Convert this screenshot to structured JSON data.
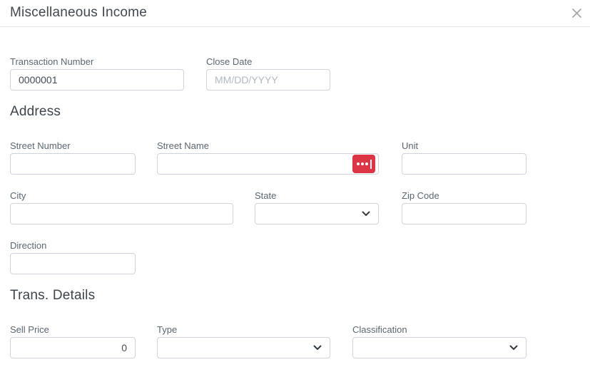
{
  "modal": {
    "title": "Miscellaneous Income"
  },
  "icons": {
    "close": "thin x glyph (two crossed lines)",
    "chevron_down": "bold v chevron on dropdowns",
    "lookup": "three white dots plus cursor bar on red button"
  },
  "colors": {
    "lookup_button_red": "#dc3545",
    "input_border": "#ced4da",
    "label_text": "#5c6670",
    "heading_text": "#3d444b",
    "placeholder_text": "#b2b9c0",
    "close_icon_gray": "#a3a3a3",
    "chevron_dark": "#343a40"
  },
  "sections": {
    "address": {
      "heading": "Address"
    },
    "trans_details": {
      "heading": "Trans. Details"
    }
  },
  "fields": {
    "transaction_number": {
      "label": "Transaction Number",
      "value": "0000001"
    },
    "close_date": {
      "label": "Close Date",
      "placeholder": "MM/DD/YYYY",
      "value": ""
    },
    "street_number": {
      "label": "Street Number",
      "value": ""
    },
    "street_name": {
      "label": "Street Name",
      "value": ""
    },
    "unit": {
      "label": "Unit",
      "value": ""
    },
    "city": {
      "label": "City",
      "value": ""
    },
    "state": {
      "label": "State",
      "selected": ""
    },
    "zip_code": {
      "label": "Zip Code",
      "value": ""
    },
    "direction": {
      "label": "Direction",
      "value": ""
    },
    "sell_price": {
      "label": "Sell Price",
      "value": "0"
    },
    "type": {
      "label": "Type",
      "selected": ""
    },
    "classification": {
      "label": "Classification",
      "selected": ""
    }
  }
}
